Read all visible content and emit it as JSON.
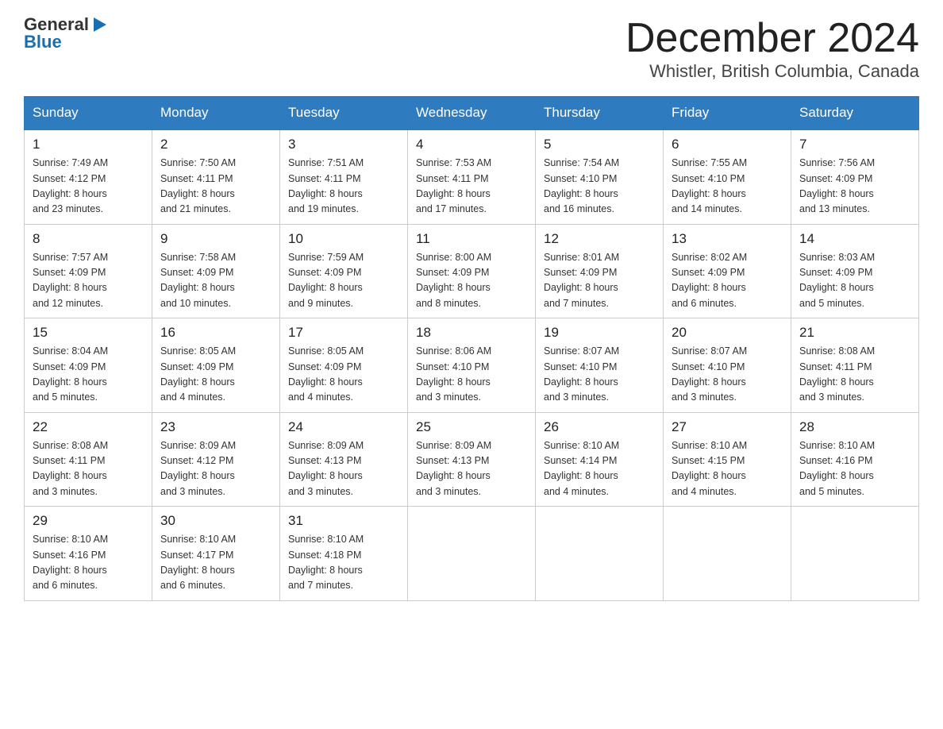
{
  "header": {
    "logo_general": "General",
    "logo_blue": "Blue",
    "title": "December 2024",
    "subtitle": "Whistler, British Columbia, Canada"
  },
  "weekdays": [
    "Sunday",
    "Monday",
    "Tuesday",
    "Wednesday",
    "Thursday",
    "Friday",
    "Saturday"
  ],
  "weeks": [
    [
      {
        "day": "1",
        "sunrise": "7:49 AM",
        "sunset": "4:12 PM",
        "daylight": "8 hours and 23 minutes."
      },
      {
        "day": "2",
        "sunrise": "7:50 AM",
        "sunset": "4:11 PM",
        "daylight": "8 hours and 21 minutes."
      },
      {
        "day": "3",
        "sunrise": "7:51 AM",
        "sunset": "4:11 PM",
        "daylight": "8 hours and 19 minutes."
      },
      {
        "day": "4",
        "sunrise": "7:53 AM",
        "sunset": "4:11 PM",
        "daylight": "8 hours and 17 minutes."
      },
      {
        "day": "5",
        "sunrise": "7:54 AM",
        "sunset": "4:10 PM",
        "daylight": "8 hours and 16 minutes."
      },
      {
        "day": "6",
        "sunrise": "7:55 AM",
        "sunset": "4:10 PM",
        "daylight": "8 hours and 14 minutes."
      },
      {
        "day": "7",
        "sunrise": "7:56 AM",
        "sunset": "4:09 PM",
        "daylight": "8 hours and 13 minutes."
      }
    ],
    [
      {
        "day": "8",
        "sunrise": "7:57 AM",
        "sunset": "4:09 PM",
        "daylight": "8 hours and 12 minutes."
      },
      {
        "day": "9",
        "sunrise": "7:58 AM",
        "sunset": "4:09 PM",
        "daylight": "8 hours and 10 minutes."
      },
      {
        "day": "10",
        "sunrise": "7:59 AM",
        "sunset": "4:09 PM",
        "daylight": "8 hours and 9 minutes."
      },
      {
        "day": "11",
        "sunrise": "8:00 AM",
        "sunset": "4:09 PM",
        "daylight": "8 hours and 8 minutes."
      },
      {
        "day": "12",
        "sunrise": "8:01 AM",
        "sunset": "4:09 PM",
        "daylight": "8 hours and 7 minutes."
      },
      {
        "day": "13",
        "sunrise": "8:02 AM",
        "sunset": "4:09 PM",
        "daylight": "8 hours and 6 minutes."
      },
      {
        "day": "14",
        "sunrise": "8:03 AM",
        "sunset": "4:09 PM",
        "daylight": "8 hours and 5 minutes."
      }
    ],
    [
      {
        "day": "15",
        "sunrise": "8:04 AM",
        "sunset": "4:09 PM",
        "daylight": "8 hours and 5 minutes."
      },
      {
        "day": "16",
        "sunrise": "8:05 AM",
        "sunset": "4:09 PM",
        "daylight": "8 hours and 4 minutes."
      },
      {
        "day": "17",
        "sunrise": "8:05 AM",
        "sunset": "4:09 PM",
        "daylight": "8 hours and 4 minutes."
      },
      {
        "day": "18",
        "sunrise": "8:06 AM",
        "sunset": "4:10 PM",
        "daylight": "8 hours and 3 minutes."
      },
      {
        "day": "19",
        "sunrise": "8:07 AM",
        "sunset": "4:10 PM",
        "daylight": "8 hours and 3 minutes."
      },
      {
        "day": "20",
        "sunrise": "8:07 AM",
        "sunset": "4:10 PM",
        "daylight": "8 hours and 3 minutes."
      },
      {
        "day": "21",
        "sunrise": "8:08 AM",
        "sunset": "4:11 PM",
        "daylight": "8 hours and 3 minutes."
      }
    ],
    [
      {
        "day": "22",
        "sunrise": "8:08 AM",
        "sunset": "4:11 PM",
        "daylight": "8 hours and 3 minutes."
      },
      {
        "day": "23",
        "sunrise": "8:09 AM",
        "sunset": "4:12 PM",
        "daylight": "8 hours and 3 minutes."
      },
      {
        "day": "24",
        "sunrise": "8:09 AM",
        "sunset": "4:13 PM",
        "daylight": "8 hours and 3 minutes."
      },
      {
        "day": "25",
        "sunrise": "8:09 AM",
        "sunset": "4:13 PM",
        "daylight": "8 hours and 3 minutes."
      },
      {
        "day": "26",
        "sunrise": "8:10 AM",
        "sunset": "4:14 PM",
        "daylight": "8 hours and 4 minutes."
      },
      {
        "day": "27",
        "sunrise": "8:10 AM",
        "sunset": "4:15 PM",
        "daylight": "8 hours and 4 minutes."
      },
      {
        "day": "28",
        "sunrise": "8:10 AM",
        "sunset": "4:16 PM",
        "daylight": "8 hours and 5 minutes."
      }
    ],
    [
      {
        "day": "29",
        "sunrise": "8:10 AM",
        "sunset": "4:16 PM",
        "daylight": "8 hours and 6 minutes."
      },
      {
        "day": "30",
        "sunrise": "8:10 AM",
        "sunset": "4:17 PM",
        "daylight": "8 hours and 6 minutes."
      },
      {
        "day": "31",
        "sunrise": "8:10 AM",
        "sunset": "4:18 PM",
        "daylight": "8 hours and 7 minutes."
      },
      null,
      null,
      null,
      null
    ]
  ],
  "labels": {
    "sunrise": "Sunrise:",
    "sunset": "Sunset:",
    "daylight": "Daylight:"
  }
}
